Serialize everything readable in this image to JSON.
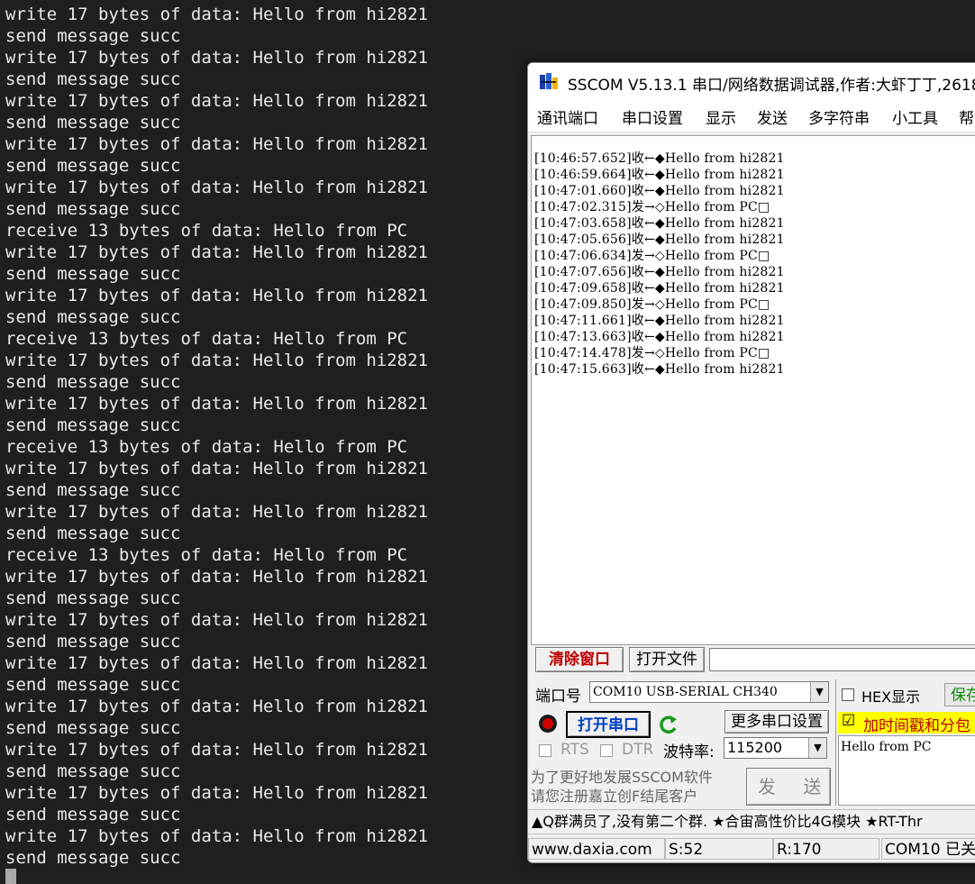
{
  "terminal": {
    "lines": [
      "write 17 bytes of data: Hello from hi2821",
      "send message succ",
      "write 17 bytes of data: Hello from hi2821",
      "send message succ",
      "write 17 bytes of data: Hello from hi2821",
      "send message succ",
      "write 17 bytes of data: Hello from hi2821",
      "send message succ",
      "write 17 bytes of data: Hello from hi2821",
      "send message succ",
      "receive 13 bytes of data: Hello from PC",
      "write 17 bytes of data: Hello from hi2821",
      "send message succ",
      "write 17 bytes of data: Hello from hi2821",
      "send message succ",
      "receive 13 bytes of data: Hello from PC",
      "write 17 bytes of data: Hello from hi2821",
      "send message succ",
      "write 17 bytes of data: Hello from hi2821",
      "send message succ",
      "receive 13 bytes of data: Hello from PC",
      "write 17 bytes of data: Hello from hi2821",
      "send message succ",
      "write 17 bytes of data: Hello from hi2821",
      "send message succ",
      "receive 13 bytes of data: Hello from PC",
      "write 17 bytes of data: Hello from hi2821",
      "send message succ",
      "write 17 bytes of data: Hello from hi2821",
      "send message succ",
      "write 17 bytes of data: Hello from hi2821",
      "send message succ",
      "write 17 bytes of data: Hello from hi2821",
      "send message succ",
      "write 17 bytes of data: Hello from hi2821",
      "send message succ",
      "write 17 bytes of data: Hello from hi2821",
      "send message succ",
      "write 17 bytes of data: Hello from hi2821",
      "send message succ"
    ]
  },
  "sscom": {
    "title": "SSCOM V5.13.1 串口/网络数据调试器,作者:大虾丁丁,2618",
    "menu": [
      "通讯端口",
      "串口设置",
      "显示",
      "发送",
      "多字符串",
      "小工具",
      "帮"
    ],
    "log": [
      "[10:46:57.652]收←◆Hello from hi2821",
      "[10:46:59.664]收←◆Hello from hi2821",
      "[10:47:01.660]收←◆Hello from hi2821",
      "[10:47:02.315]发→◇Hello from PC□",
      "[10:47:03.658]收←◆Hello from hi2821",
      "[10:47:05.656]收←◆Hello from hi2821",
      "[10:47:06.634]发→◇Hello from PC□",
      "[10:47:07.656]收←◆Hello from hi2821",
      "[10:47:09.658]收←◆Hello from hi2821",
      "[10:47:09.850]发→◇Hello from PC□",
      "[10:47:11.661]收←◆Hello from hi2821",
      "[10:47:13.663]收←◆Hello from hi2821",
      "[10:47:14.478]发→◇Hello from PC□",
      "[10:47:15.663]收←◆Hello from hi2821"
    ],
    "clear_label": "清除窗口",
    "open_file_label": "打开文件",
    "port_label": "端口号",
    "port_value": "COM10 USB-SERIAL CH340",
    "hex_display_label": "HEX显示",
    "save_label": "保存",
    "timestamp_label": "加时间戳和分包",
    "timestamp_checked": "☑",
    "open_port_label": "打开串口",
    "more_settings_label": "更多串口设置",
    "rts_label": "RTS",
    "dtr_label": "DTR",
    "baud_label": "波特率:",
    "baud_value": "115200",
    "send_text": "Hello from PC",
    "promo_line1": "为了更好地发展SSCOM软件",
    "promo_line2": "请您注册嘉立创F结尾客户",
    "send_label": "发 送",
    "ticker": "▲Q群满员了,没有第二个群. ★合宙高性价比4G模块 ★RT-Thr",
    "status": {
      "site": "www.daxia.com",
      "sent": "S:52",
      "received": "R:170",
      "port_state": "COM10 已关"
    },
    "colors": {
      "clear_button": "#c00000",
      "open_port_button": "#003fbf",
      "timestamp_highlight": "#ffff00",
      "save_button": "#0a8a0a"
    }
  }
}
